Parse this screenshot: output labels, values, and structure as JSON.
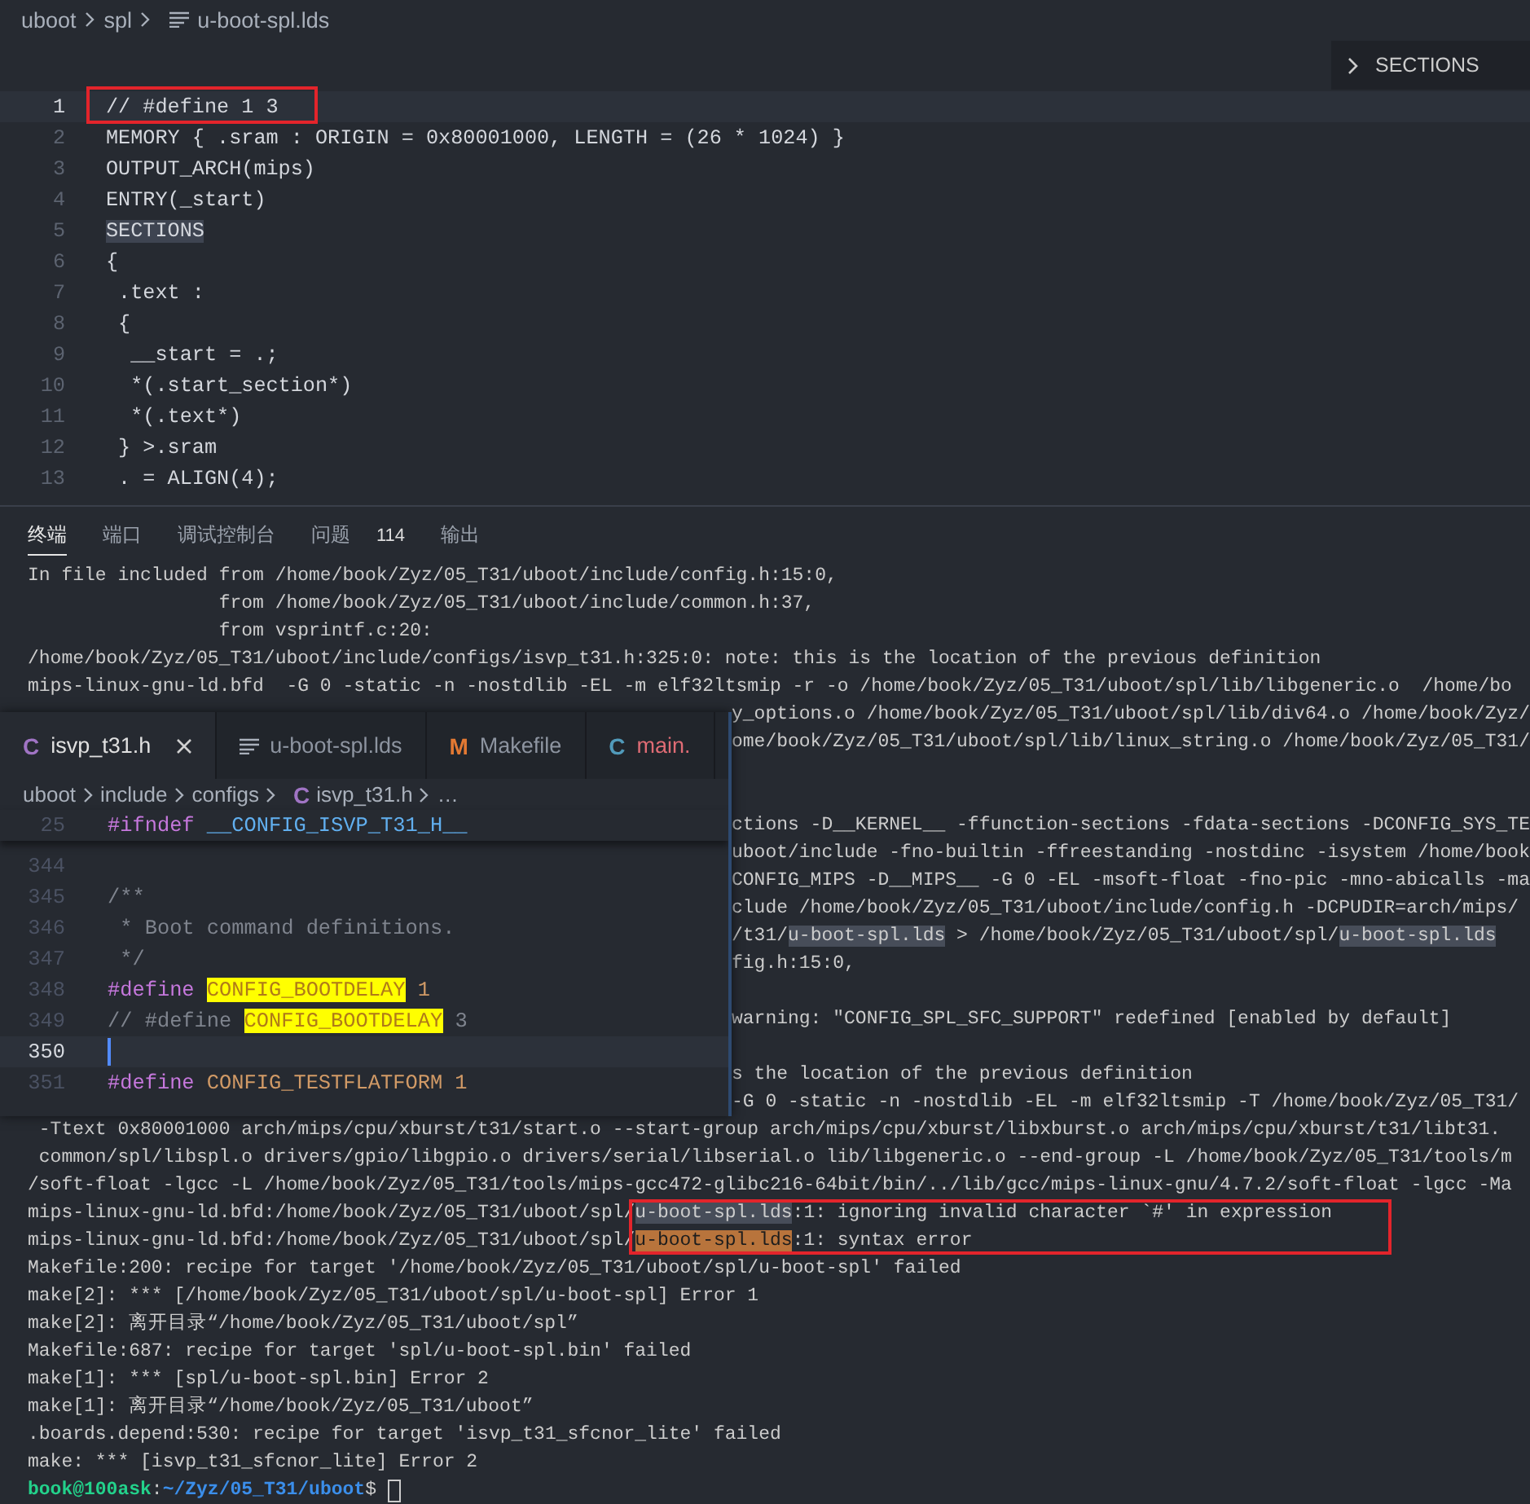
{
  "editor": {
    "breadcrumb": [
      {
        "text": "uboot"
      },
      {
        "text": "spl"
      },
      {
        "text": "u-boot-spl.lds",
        "kind": "file"
      }
    ],
    "outline_button": "SECTIONS",
    "lines": [
      {
        "number": "1",
        "text": "// #define 1 3",
        "current": true,
        "boxed": true,
        "highlighted": false
      },
      {
        "number": "2",
        "text": "MEMORY { .sram : ORIGIN = 0x80001000, LENGTH = (26 * 1024) }",
        "current": false,
        "boxed": false,
        "highlighted": false
      },
      {
        "number": "3",
        "text": "OUTPUT_ARCH(mips)",
        "current": false,
        "boxed": false,
        "highlighted": false
      },
      {
        "number": "4",
        "text": "ENTRY(_start)",
        "current": false,
        "boxed": false,
        "highlighted": false
      },
      {
        "number": "5",
        "text": "SECTIONS",
        "current": false,
        "boxed": false,
        "highlighted": true
      },
      {
        "number": "6",
        "text": "{",
        "current": false,
        "boxed": false,
        "highlighted": false
      },
      {
        "number": "7",
        "text": " .text :",
        "current": false,
        "boxed": false,
        "highlighted": false
      },
      {
        "number": "8",
        "text": " {",
        "current": false,
        "boxed": false,
        "highlighted": false
      },
      {
        "number": "9",
        "text": "  __start = .;",
        "current": false,
        "boxed": false,
        "highlighted": false
      },
      {
        "number": "10",
        "text": "  *(.start_section*)",
        "current": false,
        "boxed": false,
        "highlighted": false
      },
      {
        "number": "11",
        "text": "  *(.text*)",
        "current": false,
        "boxed": false,
        "highlighted": false
      },
      {
        "number": "12",
        "text": " } >.sram",
        "current": false,
        "boxed": false,
        "highlighted": false
      },
      {
        "number": "13",
        "text": " . = ALIGN(4);",
        "current": false,
        "boxed": false,
        "highlighted": false
      }
    ]
  },
  "terminal": {
    "tabs": [
      {
        "label": "终端",
        "selected": true
      },
      {
        "label": "端口",
        "selected": false
      },
      {
        "label": "调试控制台",
        "selected": false
      },
      {
        "label": "问题",
        "selected": false,
        "badge": "114"
      },
      {
        "label": "输出",
        "selected": false
      }
    ],
    "lines": [
      {
        "kind": "full",
        "segments": [
          {
            "text": "In file included from /home/book/Zyz/05_T31/uboot/include/config.h:15:0,",
            "kind": "plain"
          }
        ]
      },
      {
        "kind": "full",
        "segments": [
          {
            "text": "                 from /home/book/Zyz/05_T31/uboot/include/common.h:37,",
            "kind": "plain"
          }
        ]
      },
      {
        "kind": "full",
        "segments": [
          {
            "text": "                 from vsprintf.c:20:",
            "kind": "plain"
          }
        ]
      },
      {
        "kind": "full",
        "segments": [
          {
            "text": "/home/book/Zyz/05_T31/uboot/include/configs/isvp_t31.h:325:0: note: this is the location of the previous definition",
            "kind": "plain"
          }
        ]
      },
      {
        "kind": "full",
        "segments": [
          {
            "text": "mips-linux-gnu-ld.bfd  -G 0 -static -n -nostdlib -EL -m elf32ltsmip -r -o /home/book/Zyz/05_T31/uboot/spl/lib/libgeneric.o  /home/bo",
            "kind": "plain"
          }
        ]
      },
      {
        "kind": "partial",
        "segments": [
          {
            "text": "y_options.o /home/book/Zyz/05_T31/uboot/spl/lib/div64.o /home/book/Zyz/",
            "kind": "plain"
          }
        ]
      },
      {
        "kind": "partial",
        "segments": [
          {
            "text": "ome/book/Zyz/05_T31/uboot/spl/lib/linux_string.o /home/book/Zyz/05_T31/",
            "kind": "plain"
          }
        ]
      },
      {
        "kind": "blank"
      },
      {
        "kind": "blank"
      },
      {
        "kind": "partial",
        "segments": [
          {
            "text": "ctions -D__KERNEL__ -ffunction-sections -fdata-sections -DCONFIG_SYS_TE",
            "kind": "plain"
          }
        ]
      },
      {
        "kind": "partial",
        "segments": [
          {
            "text": "uboot/include -fno-builtin -ffreestanding -nostdinc -isystem /home/book",
            "kind": "plain"
          }
        ]
      },
      {
        "kind": "partial",
        "segments": [
          {
            "text": "CONFIG_MIPS -D__MIPS__ -G 0 -EL -msoft-float -fno-pic -mno-abicalls -ma",
            "kind": "plain"
          }
        ]
      },
      {
        "kind": "partial",
        "segments": [
          {
            "text": "clude /home/book/Zyz/05_T31/uboot/include/config.h -DCPUDIR=arch/mips/",
            "kind": "plain"
          }
        ]
      },
      {
        "kind": "partial",
        "segments": [
          {
            "text": "/t31/",
            "kind": "plain"
          },
          {
            "text": "u-boot-spl.lds",
            "kind": "match"
          },
          {
            "text": " > /home/book/Zyz/05_T31/uboot/spl/",
            "kind": "plain"
          },
          {
            "text": "u-boot-spl.lds",
            "kind": "match"
          }
        ]
      },
      {
        "kind": "partial",
        "segments": [
          {
            "text": "fig.h:15:0,",
            "kind": "plain"
          }
        ]
      },
      {
        "kind": "blank"
      },
      {
        "kind": "partial",
        "segments": [
          {
            "text": "warning: \"CONFIG_SPL_SFC_SUPPORT\" redefined [enabled by default]",
            "kind": "plain"
          }
        ]
      },
      {
        "kind": "blank"
      },
      {
        "kind": "partial",
        "segments": [
          {
            "text": "s the location of the previous definition",
            "kind": "plain"
          }
        ]
      },
      {
        "kind": "partial",
        "segments": [
          {
            "text": "-G 0 -static -n -nostdlib -EL -m elf32ltsmip -T /home/book/Zyz/05_T31/",
            "kind": "plain"
          }
        ]
      },
      {
        "kind": "full",
        "segments": [
          {
            "text": " -Ttext 0x80001000 arch/mips/cpu/xburst/t31/start.o --start-group arch/mips/cpu/xburst/libxburst.o arch/mips/cpu/xburst/t31/libt31.",
            "kind": "plain"
          }
        ]
      },
      {
        "kind": "full",
        "segments": [
          {
            "text": " common/spl/libspl.o drivers/gpio/libgpio.o drivers/serial/libserial.o lib/libgeneric.o --end-group -L /home/book/Zyz/05_T31/tools/m",
            "kind": "plain"
          }
        ]
      },
      {
        "kind": "full",
        "segments": [
          {
            "text": "/soft-float -lgcc -L /home/book/Zyz/05_T31/tools/mips-gcc472-glibc216-64bit/bin/../lib/gcc/mips-linux-gnu/4.7.2/soft-float -lgcc -Ma",
            "kind": "plain"
          }
        ]
      },
      {
        "kind": "full",
        "boxed": true,
        "segments": [
          {
            "text": "mips-linux-gnu-ld.bfd:/home/book/Zyz/05_T31/uboot/spl/",
            "kind": "plain"
          },
          {
            "text": "u-boot-spl.lds",
            "kind": "match"
          },
          {
            "text": ":1: ignoring invalid character `#' in expression",
            "kind": "plain"
          }
        ]
      },
      {
        "kind": "full",
        "boxed": true,
        "segments": [
          {
            "text": "mips-linux-gnu-ld.bfd:/home/book/Zyz/05_T31/uboot/spl/",
            "kind": "plain"
          },
          {
            "text": "u-boot-spl.lds",
            "kind": "active-match"
          },
          {
            "text": ":1: syntax error",
            "kind": "plain"
          }
        ]
      },
      {
        "kind": "full",
        "segments": [
          {
            "text": "Makefile:200: recipe for target '/home/book/Zyz/05_T31/uboot/spl/u-boot-spl' failed",
            "kind": "plain"
          }
        ]
      },
      {
        "kind": "full",
        "segments": [
          {
            "text": "make[2]: *** [/home/book/Zyz/05_T31/uboot/spl/u-boot-spl] Error 1",
            "kind": "plain"
          }
        ]
      },
      {
        "kind": "full",
        "segments": [
          {
            "text": "make[2]: 离开目录“/home/book/Zyz/05_T31/uboot/spl”",
            "kind": "plain"
          }
        ]
      },
      {
        "kind": "full",
        "segments": [
          {
            "text": "Makefile:687: recipe for target 'spl/u-boot-spl.bin' failed",
            "kind": "plain"
          }
        ]
      },
      {
        "kind": "full",
        "segments": [
          {
            "text": "make[1]: *** [spl/u-boot-spl.bin] Error 2",
            "kind": "plain"
          }
        ]
      },
      {
        "kind": "full",
        "segments": [
          {
            "text": "make[1]: 离开目录“/home/book/Zyz/05_T31/uboot”",
            "kind": "plain"
          }
        ]
      },
      {
        "kind": "full",
        "segments": [
          {
            "text": ".boards.depend:530: recipe for target 'isvp_t31_sfcnor_lite' failed",
            "kind": "plain"
          }
        ]
      },
      {
        "kind": "full",
        "segments": [
          {
            "text": "make: *** [isvp_t31_sfcnor_lite] Error 2",
            "kind": "plain"
          }
        ]
      },
      {
        "kind": "prompt",
        "segments": [
          {
            "text": "book@100ask",
            "kind": "user"
          },
          {
            "text": ":",
            "kind": "plain"
          },
          {
            "text": "~/Zyz/05_T31/uboot",
            "kind": "path"
          },
          {
            "text": "$ ",
            "kind": "plain"
          }
        ]
      }
    ]
  },
  "overlay": {
    "tabs": [
      {
        "glyph": "C",
        "color": "#a074c4",
        "label": "isvp_t31.h",
        "selected": true,
        "error": false
      },
      {
        "kind": "document",
        "label": "u-boot-spl.lds",
        "selected": false,
        "error": false
      },
      {
        "glyph": "M",
        "color": "#e37933",
        "label": "Makefile",
        "selected": false,
        "error": false
      },
      {
        "glyph": "C",
        "color": "#519aba",
        "label": "main.",
        "selected": false,
        "error": true
      }
    ],
    "breadcrumb": [
      {
        "text": "uboot"
      },
      {
        "text": "include"
      },
      {
        "text": "configs"
      },
      {
        "glyph": "C",
        "text": "isvp_t31.h"
      },
      {
        "text": "…"
      }
    ],
    "lines": [
      {
        "number": "25",
        "sticky": true,
        "current": false,
        "segments": [
          {
            "text": "#ifndef",
            "kind": "keyword",
            "highlighted": false
          },
          {
            "text": " __CONFIG_ISVP_T31_H__",
            "kind": "macro",
            "highlighted": false
          }
        ]
      },
      {
        "number": "344",
        "current": false
      },
      {
        "number": "345",
        "current": false,
        "segments": [
          {
            "text": "/**",
            "kind": "comment",
            "highlighted": false
          }
        ]
      },
      {
        "number": "346",
        "current": false,
        "segments": [
          {
            "text": " * Boot command definitions.",
            "kind": "comment",
            "highlighted": false
          }
        ]
      },
      {
        "number": "347",
        "current": false,
        "segments": [
          {
            "text": " */",
            "kind": "comment",
            "highlighted": false
          }
        ]
      },
      {
        "number": "348",
        "current": false,
        "segments": [
          {
            "text": "#define ",
            "kind": "keyword",
            "highlighted": false
          },
          {
            "text": "CONFIG_BOOTDELAY",
            "kind": "constant",
            "highlighted": true
          },
          {
            "text": " 1",
            "kind": "constant",
            "highlighted": false
          }
        ]
      },
      {
        "number": "349",
        "current": false,
        "segments": [
          {
            "text": "// #define ",
            "kind": "comment",
            "highlighted": false
          },
          {
            "text": "CONFIG_BOOTDELAY",
            "kind": "comment",
            "highlighted": true
          },
          {
            "text": " 3",
            "kind": "comment",
            "highlighted": false
          }
        ]
      },
      {
        "number": "350",
        "current": true
      },
      {
        "number": "351",
        "current": false,
        "segments": [
          {
            "text": "#define",
            "kind": "keyword",
            "highlighted": false
          },
          {
            "text": " CONFIG_TESTFLATFORM 1",
            "kind": "constant",
            "highlighted": false
          }
        ]
      }
    ]
  }
}
